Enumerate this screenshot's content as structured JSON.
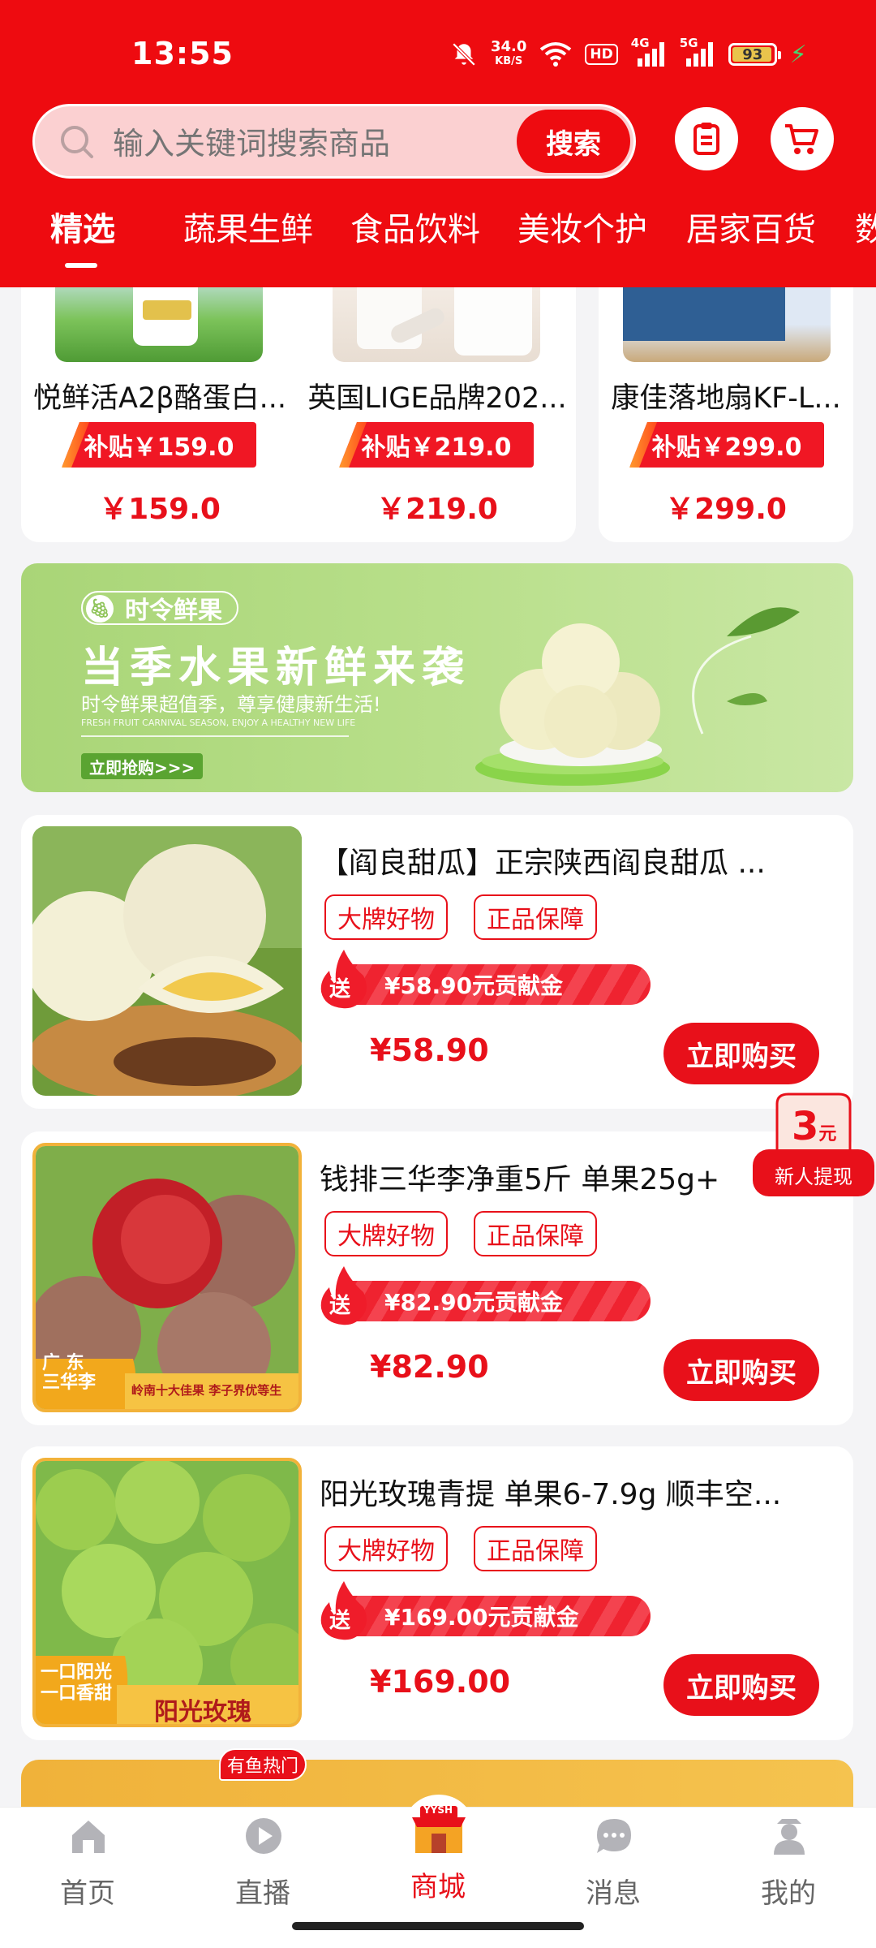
{
  "status_bar": {
    "time": "13:55",
    "net_speed_value": "34.0",
    "net_speed_unit": "KB/S",
    "hd_label": "HD",
    "sig1_label": "4G",
    "sig2_label": "5G",
    "battery": "93"
  },
  "search": {
    "placeholder": "输入关键词搜索商品",
    "button_label": "搜索"
  },
  "tabs": [
    {
      "label": "精选",
      "active": true
    },
    {
      "label": "蔬果生鲜"
    },
    {
      "label": "食品饮料"
    },
    {
      "label": "美妆个护"
    },
    {
      "label": "居家百货"
    },
    {
      "label": "数"
    }
  ],
  "top_products": [
    {
      "name": "悦鲜活A2β酪蛋白...",
      "subsidy": "补贴￥159.0",
      "price": "￥159.0"
    },
    {
      "name": "英国LIGE品牌202...",
      "subsidy": "补贴￥219.0",
      "price": "￥219.0"
    },
    {
      "name": "康佳落地扇KF-L...",
      "subsidy": "补贴￥299.0",
      "price": "￥299.0"
    }
  ],
  "banner": {
    "tag": "时令鲜果",
    "title": "当季水果新鲜来袭",
    "subtitle": "时令鲜果超值季，尊享健康新生活!",
    "english": "FRESH FRUIT CARNIVAL SEASON, ENJOY A HEALTHY NEW LIFE",
    "button": "立即抢购>>>"
  },
  "products": [
    {
      "title": "【阎良甜瓜】正宗陕西阎良甜瓜 ...",
      "badges": [
        "大牌好物",
        "正品保障"
      ],
      "send_label": "送",
      "contribution": "¥58.90元贡献金",
      "price": "¥58.90",
      "buy_label": "立即购买"
    },
    {
      "title": "钱排三华李净重5斤 单果25g+",
      "badges": [
        "大牌好物",
        "正品保障"
      ],
      "send_label": "送",
      "contribution": "¥82.90元贡献金",
      "price": "¥82.90",
      "buy_label": "立即购买",
      "image_text_1": "广 东\n三华李",
      "image_text_2": "岭南十大佳果 李子界优等生"
    },
    {
      "title": "阳光玫瑰青提 单果6-7.9g  顺丰空...",
      "badges": [
        "大牌好物",
        "正品保障"
      ],
      "send_label": "送",
      "contribution": "¥169.00元贡献金",
      "price": "¥169.00",
      "buy_label": "立即购买",
      "image_text_1": "一口阳光\n一口香甜",
      "image_text_2": "阳光玫瑰"
    }
  ],
  "coupon": {
    "amount": "3",
    "unit": "元",
    "label": "新人提现"
  },
  "hot_tag": "有鱼热门",
  "store_sign": "YYSH",
  "bottom_nav": [
    {
      "label": "首页",
      "icon": "home-icon"
    },
    {
      "label": "直播",
      "icon": "live-icon"
    },
    {
      "label": "商城",
      "icon": "store-icon",
      "active": true
    },
    {
      "label": "消息",
      "icon": "message-icon"
    },
    {
      "label": "我的",
      "icon": "profile-icon"
    }
  ],
  "colors": {
    "brand_red": "#ee0b10",
    "price_red": "#e8101a",
    "banner_green": "#a9d577"
  }
}
